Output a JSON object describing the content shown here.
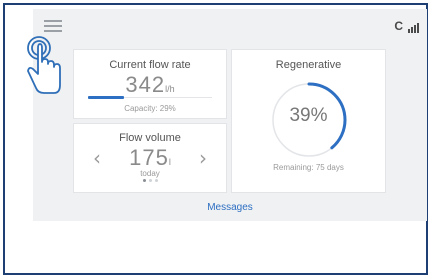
{
  "header": {
    "menu_icon": "hamburger-menu-icon",
    "status_letter": "C",
    "signal_icon": "signal-bars-icon"
  },
  "flow_rate": {
    "title": "Current flow rate",
    "value": "342",
    "unit": "l/h",
    "capacity_label": "Capacity: 29%",
    "capacity_fraction": 0.29
  },
  "flow_volume": {
    "title": "Flow volume",
    "value": "175",
    "unit": "l",
    "period": "today",
    "prev_icon": "chevron-left-icon",
    "next_icon": "chevron-right-icon",
    "page_count": 3,
    "active_page": 1
  },
  "regenerative": {
    "title": "Regenerative",
    "value": "39%",
    "fraction": 0.39,
    "remaining": "Remaining: 75 days"
  },
  "footer": {
    "messages_link": "Messages"
  },
  "overlay": {
    "icon": "tap-gesture-hand-icon"
  },
  "colors": {
    "accent": "#2d6fc2",
    "frame": "#1d3f73",
    "screen_bg": "#f0f1f3",
    "card_bg": "#ffffff"
  }
}
